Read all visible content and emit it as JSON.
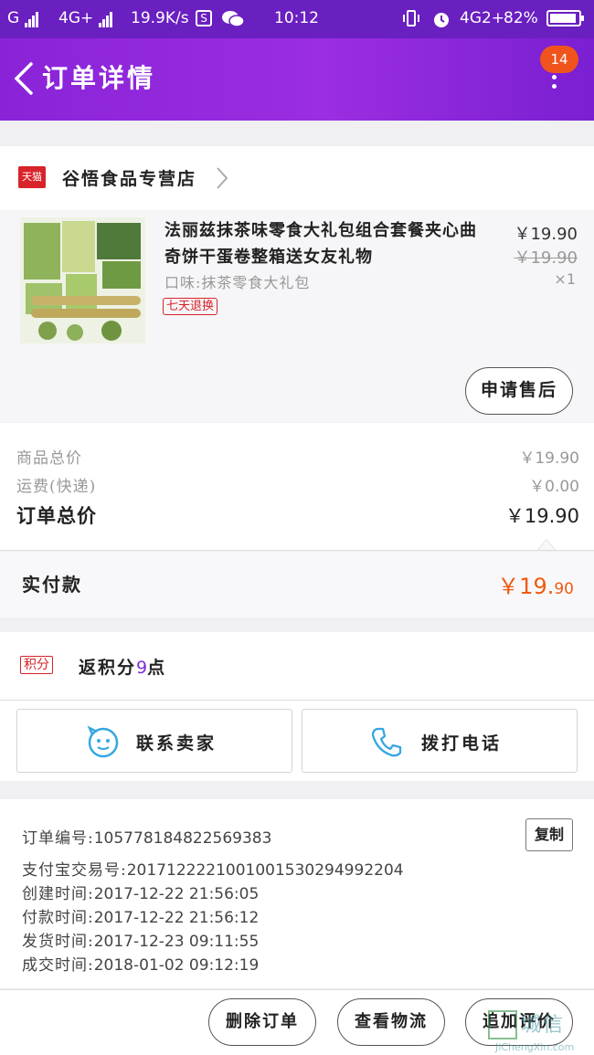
{
  "status_bar": {
    "network_left": "G",
    "network_mid": "4G+",
    "speed": "19.9K/s",
    "app_s": "S",
    "time": "10:12",
    "network_right": "4G2+",
    "battery": "82%"
  },
  "header": {
    "title": "订单详情",
    "badge": "14",
    "color": "#8a23d8"
  },
  "store": {
    "tag": "天猫",
    "name": "谷悟食品专营店"
  },
  "product": {
    "title": "法丽兹抹茶味零食大礼包组合套餐夹心曲奇饼干蛋卷整箱送女友礼物",
    "spec": "口味:抹茶零食大礼包",
    "return_tag": "七天退换",
    "price": "￥19.90",
    "original_price": "￥19.90",
    "quantity": "×1",
    "after_sale_button": "申请售后"
  },
  "summary": {
    "goods_total_label": "商品总价",
    "goods_total_value": "￥19.90",
    "shipping_label": "运费(快递)",
    "shipping_value": "￥0.00",
    "order_total_label": "订单总价",
    "order_total_value": "￥19.90",
    "paid_label": "实付款",
    "paid_main": "￥19.",
    "paid_cents": "90",
    "accent": "#ef5a10"
  },
  "points": {
    "tag": "积分",
    "prefix": "返积分",
    "number": "9",
    "suffix": "点"
  },
  "contacts": {
    "seller_label": "联系卖家",
    "phone_label": "拨打电话"
  },
  "order_info": {
    "order_no_label": "订单编号:",
    "order_no": "105778184822569383",
    "copy_button": "复制",
    "alipay_label": "支付宝交易号:",
    "alipay_no": "2017122221001001530294992204",
    "created_label": "创建时间:",
    "created": "2017-12-22 21:56:05",
    "paid_label": "付款时间:",
    "paid": "2017-12-22 21:56:12",
    "shipped_label": "发货时间:",
    "shipped": "2017-12-23 09:11:55",
    "closed_label": "成交时间:",
    "closed": "2018-01-02 09:12:19"
  },
  "actions": {
    "delete": "删除订单",
    "logistics": "查看物流",
    "review": "追加评价"
  },
  "watermark": {
    "text": "城信",
    "url": "JiChengXin.com"
  }
}
